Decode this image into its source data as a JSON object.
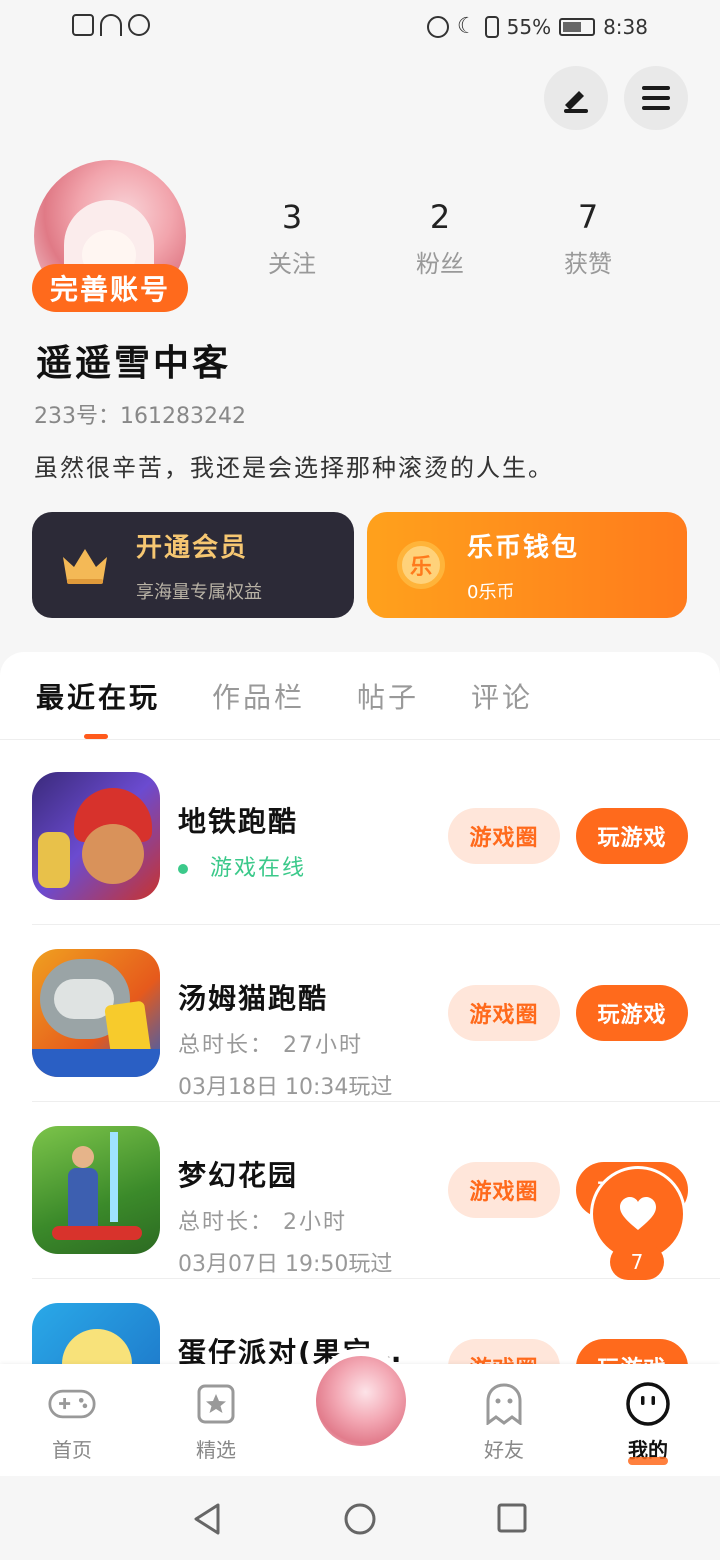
{
  "status_bar": {
    "battery": "55%",
    "time": "8:38"
  },
  "profile": {
    "badge": "完善账号",
    "stats": [
      {
        "value": "3",
        "label": "关注"
      },
      {
        "value": "2",
        "label": "粉丝"
      },
      {
        "value": "7",
        "label": "获赞"
      }
    ],
    "nickname": "遥遥雪中客",
    "uid": "233号：161283242",
    "bio": "虽然很辛苦，我还是会选择那种滚烫的人生。"
  },
  "cards": {
    "vip": {
      "title": "开通会员",
      "subtitle": "享海量专属权益"
    },
    "wallet": {
      "title": "乐币钱包",
      "subtitle": "0乐币",
      "coin": "乐"
    }
  },
  "tabs": [
    "最近在玩",
    "作品栏",
    "帖子",
    "评论"
  ],
  "games": [
    {
      "name": "地铁跑酷",
      "line1": "游戏在线",
      "line2": ""
    },
    {
      "name": "汤姆猫跑酷",
      "line1": "总时长：  27小时",
      "line2": "03月18日 10:34玩过"
    },
    {
      "name": "梦幻花园",
      "line1": "总时长：  2小时",
      "line2": "03月07日 19:50玩过"
    },
    {
      "name": "蛋仔派对(果宝…",
      "line1": "",
      "line2": ""
    }
  ],
  "game_buttons": {
    "circle": "游戏圈",
    "play": "玩游戏"
  },
  "like_count": "7",
  "bottom_nav": [
    "首页",
    "精选",
    "好友",
    "我的"
  ]
}
